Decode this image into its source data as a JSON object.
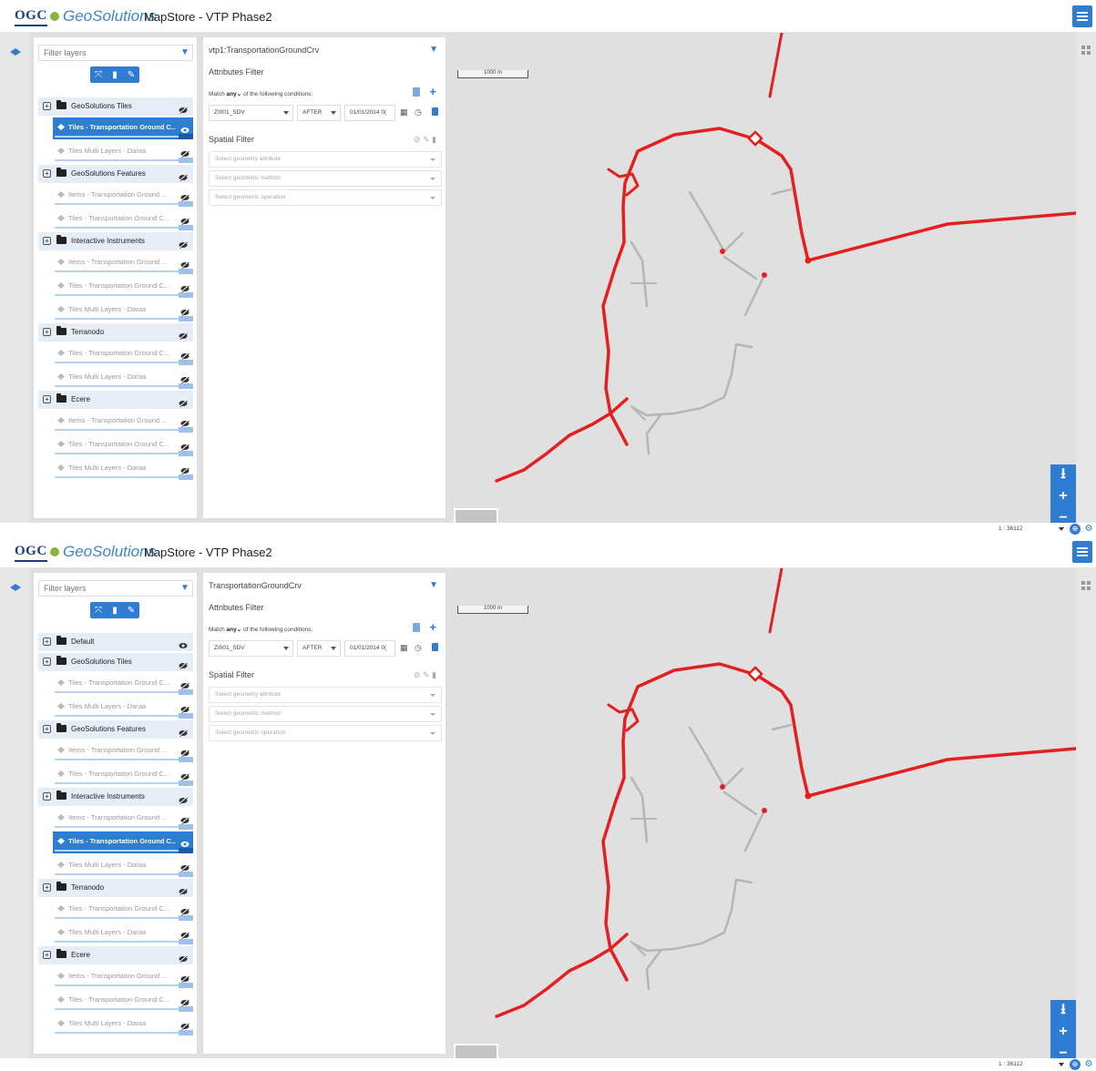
{
  "app": {
    "logo_ogc": "OGC",
    "logo_geosolutions": "GeoSolutions",
    "title": "MapStore - VTP Phase2"
  },
  "colors": {
    "accent": "#2f7cd3",
    "road_red": "#e41f1f",
    "road_grey": "#b5b5b5",
    "map_bg": "#e0e0e0"
  },
  "screens": [
    {
      "toc": {
        "filter_placeholder": "Filter layers",
        "groups": [
          {
            "label": "GeoSolutions Tiles",
            "visible": false,
            "layers": [
              {
                "label": "Tiles - Transportation Ground C...",
                "selected": true,
                "visible": true
              },
              {
                "label": "Tiles Multi Layers - Daraa",
                "selected": false,
                "visible": false
              }
            ]
          },
          {
            "label": "GeoSolutions Features",
            "visible": false,
            "layers": [
              {
                "label": "Items - Transportation Ground ...",
                "selected": false,
                "visible": false
              },
              {
                "label": "Tiles - Transportation Ground C...",
                "selected": false,
                "visible": false
              }
            ]
          },
          {
            "label": "Interactive Instruments",
            "visible": false,
            "layers": [
              {
                "label": "Items - Transportation Ground ...",
                "selected": false,
                "visible": false
              },
              {
                "label": "Tiles - Transportation Ground C...",
                "selected": false,
                "visible": false
              },
              {
                "label": "Tiles Multi Layers - Daraa",
                "selected": false,
                "visible": false
              }
            ]
          },
          {
            "label": "Terranodo",
            "visible": false,
            "layers": [
              {
                "label": "Tiles - Transportation Ground C...",
                "selected": false,
                "visible": false
              },
              {
                "label": "Tiles Multi Layers - Daraa",
                "selected": false,
                "visible": false
              }
            ]
          },
          {
            "label": "Ecere",
            "visible": false,
            "layers": [
              {
                "label": "Items - Transportation Ground ...",
                "selected": false,
                "visible": false
              },
              {
                "label": "Tiles - Transportation Ground C...",
                "selected": false,
                "visible": false
              },
              {
                "label": "Tiles Multi Layers - Daraa",
                "selected": false,
                "visible": false
              }
            ]
          }
        ]
      },
      "query": {
        "title": "vtp1:TransportationGroundCrv",
        "attributes_filter": "Attributes Filter",
        "match_prefix": "Match",
        "match_any": "any",
        "match_suffix": "of the following conditions:",
        "attribute": "ZI001_SDV",
        "operator": "AFTER",
        "date_value": "01/01/2014 0(",
        "spatial_filter": "Spatial Filter",
        "geom_attr_placeholder": "Select geometry attribute",
        "geom_method_placeholder": "Select geometric method",
        "geom_op_placeholder": "Select geometric operation"
      },
      "map": {
        "scalebar_label": "1000 m",
        "scale_value": "1 : 36112"
      }
    },
    {
      "toc": {
        "filter_placeholder": "Filter layers",
        "groups": [
          {
            "label": "Default",
            "visible": true,
            "layers": []
          },
          {
            "label": "GeoSolutions Tiles",
            "visible": false,
            "layers": [
              {
                "label": "Tiles - Transportation Ground C...",
                "selected": false,
                "visible": false
              },
              {
                "label": "Tiles Multi Layers - Daraa",
                "selected": false,
                "visible": false
              }
            ]
          },
          {
            "label": "GeoSolutions Features",
            "visible": false,
            "layers": [
              {
                "label": "Items - Transportation Ground ...",
                "selected": false,
                "visible": false
              },
              {
                "label": "Tiles - Transportation Ground C...",
                "selected": false,
                "visible": false
              }
            ]
          },
          {
            "label": "Interactive Instruments",
            "visible": false,
            "layers": [
              {
                "label": "Items - Transportation Ground ...",
                "selected": false,
                "visible": false
              },
              {
                "label": "Tiles - Transportation Ground C...",
                "selected": true,
                "visible": true
              },
              {
                "label": "Tiles Multi Layers - Daraa",
                "selected": false,
                "visible": false
              }
            ]
          },
          {
            "label": "Terranodo",
            "visible": false,
            "layers": [
              {
                "label": "Tiles - Transportation Ground C...",
                "selected": false,
                "visible": false
              },
              {
                "label": "Tiles Multi Layers - Daraa",
                "selected": false,
                "visible": false
              }
            ]
          },
          {
            "label": "Ecere",
            "visible": false,
            "layers": [
              {
                "label": "Items - Transportation Ground ...",
                "selected": false,
                "visible": false
              },
              {
                "label": "Tiles - Transportation Ground C...",
                "selected": false,
                "visible": false
              },
              {
                "label": "Tiles Multi Layers - Daraa",
                "selected": false,
                "visible": false
              }
            ]
          }
        ]
      },
      "query": {
        "title": "TransportationGroundCrv",
        "attributes_filter": "Attributes Filter",
        "match_prefix": "Match",
        "match_any": "any",
        "match_suffix": "of the following conditions:",
        "attribute": "ZI001_SDV",
        "operator": "AFTER",
        "date_value": "01/01/2014 0(",
        "spatial_filter": "Spatial Filter",
        "geom_attr_placeholder": "Select geometry attribute",
        "geom_method_placeholder": "Select geometric method",
        "geom_op_placeholder": "Select geometric operation"
      },
      "map": {
        "scalebar_label": "1000 m",
        "scale_value": "1 : 36112"
      }
    }
  ]
}
